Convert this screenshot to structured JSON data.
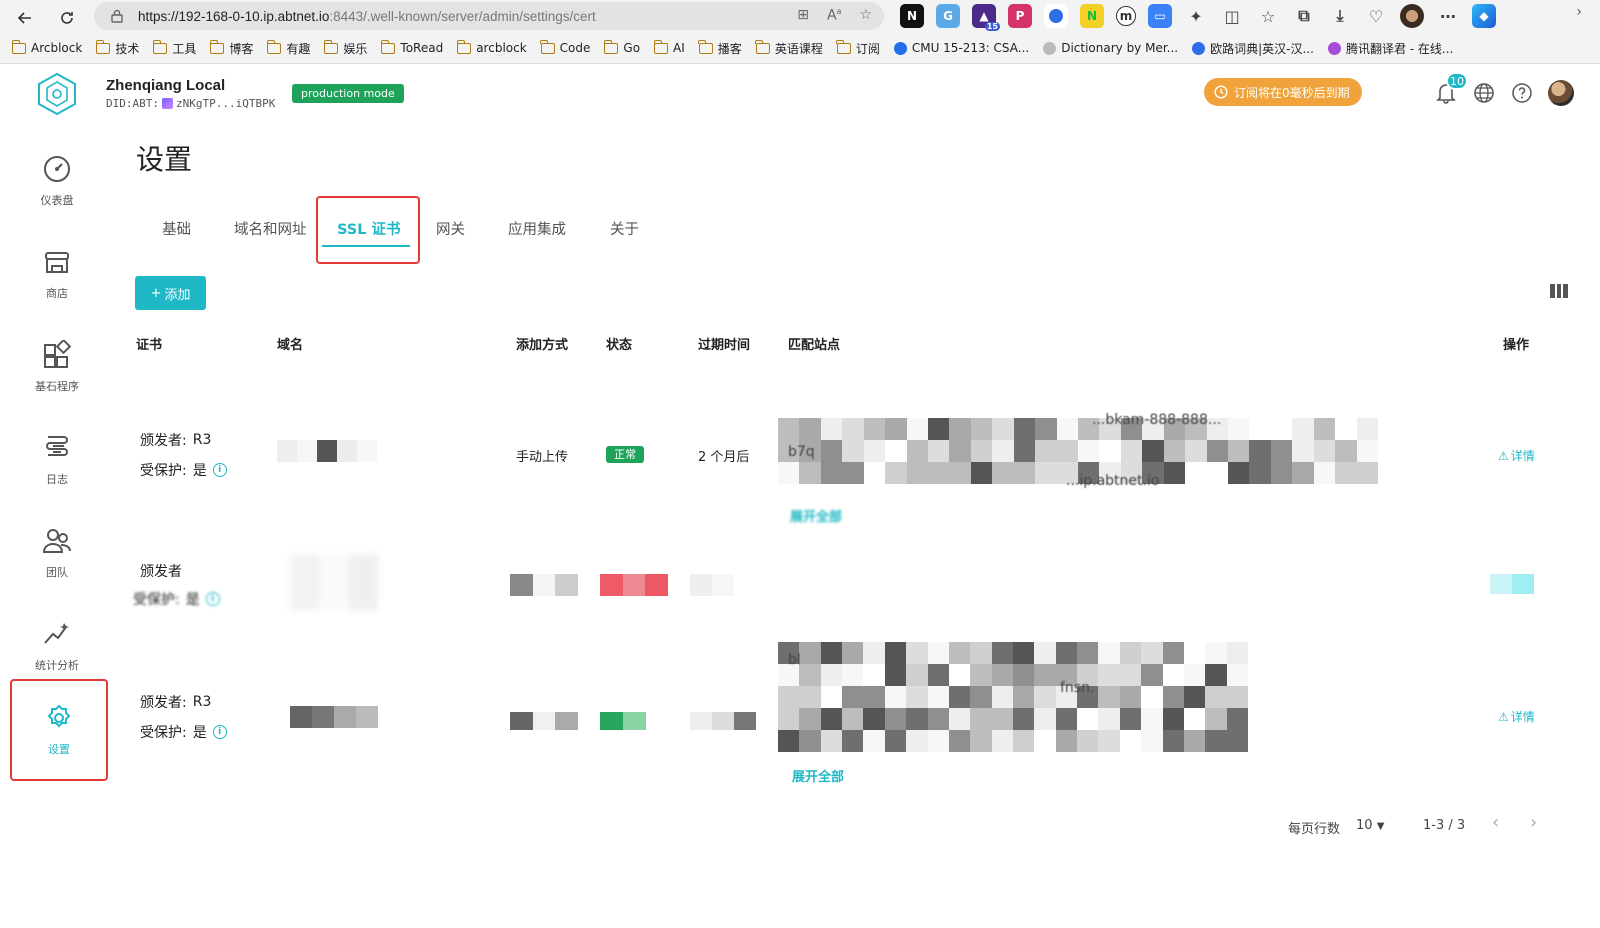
{
  "browser": {
    "url_host": "https://192-168-0-10.ip.abtnet.io",
    "url_path": ":8443/.well-known/server/admin/settings/cert",
    "bookmarks": [
      {
        "label": "Arcblock",
        "type": "folder"
      },
      {
        "label": "技术",
        "type": "folder"
      },
      {
        "label": "工具",
        "type": "folder"
      },
      {
        "label": "博客",
        "type": "folder"
      },
      {
        "label": "有趣",
        "type": "folder"
      },
      {
        "label": "娱乐",
        "type": "folder"
      },
      {
        "label": "ToRead",
        "type": "folder"
      },
      {
        "label": "arcblock",
        "type": "folder"
      },
      {
        "label": "Code",
        "type": "folder"
      },
      {
        "label": "Go",
        "type": "folder"
      },
      {
        "label": "AI",
        "type": "folder"
      },
      {
        "label": "播客",
        "type": "folder"
      },
      {
        "label": "英语课程",
        "type": "folder"
      },
      {
        "label": "订阅",
        "type": "folder"
      },
      {
        "label": "CMU 15-213: CSA...",
        "type": "site"
      },
      {
        "label": "Dictionary by Mer...",
        "type": "site"
      },
      {
        "label": "欧路词典|英汉-汉...",
        "type": "site"
      },
      {
        "label": "腾讯翻译君 - 在线...",
        "type": "site"
      }
    ],
    "extension_badge": "15"
  },
  "header": {
    "node_name": "Zhenqiang Local",
    "did_prefix": "DID:ABT:",
    "did_value": "zNKgTP...iQTBPK",
    "mode_badge": "production mode",
    "subscription_notice": "订阅将在0毫秒后到期",
    "notification_count": "10",
    "colors": {
      "accent": "#1fb8c7",
      "success": "#1fa35a",
      "warning": "#f0a33a",
      "highlight": "#e33a3a"
    }
  },
  "sidebar": {
    "items": [
      {
        "label": "仪表盘",
        "icon": "dashboard-icon"
      },
      {
        "label": "商店",
        "icon": "store-icon"
      },
      {
        "label": "基石程序",
        "icon": "blocklets-icon"
      },
      {
        "label": "日志",
        "icon": "log-icon"
      },
      {
        "label": "团队",
        "icon": "team-icon"
      },
      {
        "label": "统计分析",
        "icon": "analytics-icon"
      },
      {
        "label": "设置",
        "icon": "settings-icon",
        "active": true
      }
    ]
  },
  "main": {
    "title": "设置",
    "tabs": [
      {
        "label": "基础"
      },
      {
        "label": "域名和网址"
      },
      {
        "label": "SSL 证书",
        "active": true
      },
      {
        "label": "网关"
      },
      {
        "label": "应用集成"
      },
      {
        "label": "关于"
      }
    ],
    "add_button": "添加",
    "table": {
      "columns": [
        "证书",
        "域名",
        "添加方式",
        "状态",
        "过期时间",
        "匹配站点",
        "操作"
      ],
      "rows": [
        {
          "issuer_label": "颁发者:",
          "issuer": "R3",
          "protected_label": "受保护:",
          "protected": "是",
          "add_method": "手动上传",
          "status": "正常",
          "expires": "2 个月后",
          "sites_visible": [
            "b7q",
            "...bkam-888-888...",
            "...ip.abtnet.io"
          ],
          "expand": "展开全部",
          "action": "详情"
        },
        {
          "issuer_label": "颁发者",
          "issuer": "",
          "protected_label": "受保护:",
          "protected": "是"
        },
        {
          "issuer_label": "颁发者:",
          "issuer": "R3",
          "protected_label": "受保护:",
          "protected": "是",
          "sites_visible": [
            "bl",
            "fnsn."
          ],
          "expand": "展开全部",
          "action": "详情"
        }
      ]
    },
    "pagination": {
      "rows_per_page_label": "每页行数",
      "rows_per_page": "10",
      "range": "1-3 / 3"
    }
  }
}
